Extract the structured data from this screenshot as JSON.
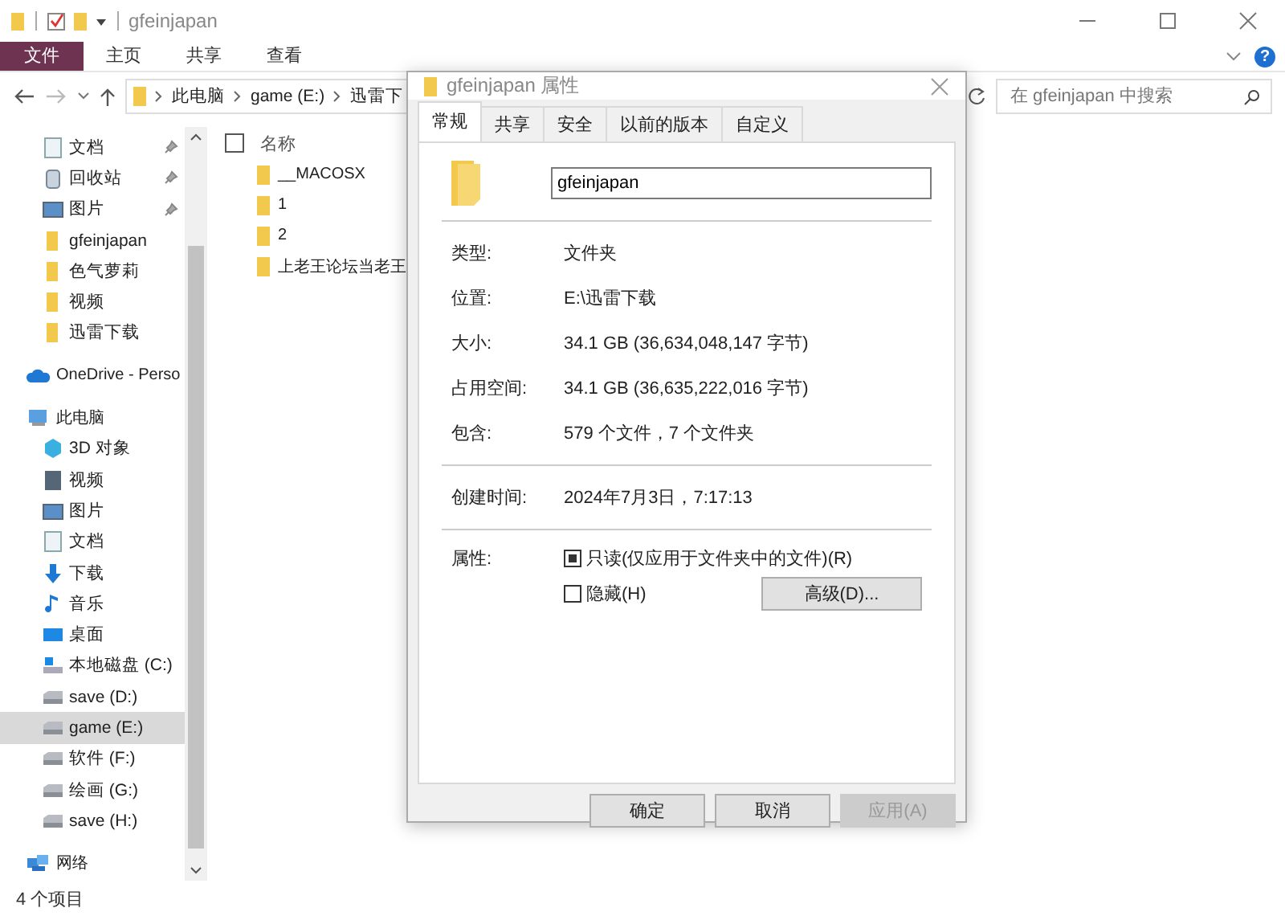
{
  "window": {
    "title": "gfeinjapan"
  },
  "ribbon": {
    "tabs": [
      {
        "label": "文件",
        "selected": true
      },
      {
        "label": "主页",
        "selected": false
      },
      {
        "label": "共享",
        "selected": false
      },
      {
        "label": "查看",
        "selected": false
      }
    ],
    "help": "?"
  },
  "address": {
    "crumbs": [
      "此电脑",
      "game (E:)",
      "迅雷下"
    ]
  },
  "search": {
    "placeholder": "在 gfeinjapan 中搜索"
  },
  "sidebar": {
    "quick_access": [
      {
        "label": "文档",
        "kind": "doc",
        "pinned": true,
        "selected": false
      },
      {
        "label": "回收站",
        "kind": "recycle",
        "pinned": true,
        "selected": false
      },
      {
        "label": "图片",
        "kind": "image",
        "pinned": true,
        "selected": false
      },
      {
        "label": "gfeinjapan",
        "kind": "folder",
        "pinned": false,
        "selected": false
      },
      {
        "label": "色气萝莉",
        "kind": "folder",
        "pinned": false,
        "selected": false
      },
      {
        "label": "视频",
        "kind": "folder",
        "pinned": false,
        "selected": false
      },
      {
        "label": "迅雷下载",
        "kind": "folder",
        "pinned": false,
        "selected": false
      }
    ],
    "roots": [
      {
        "label": "OneDrive - Perso",
        "kind": "cloud",
        "selected": false
      },
      {
        "label": "此电脑",
        "kind": "pc",
        "selected": false,
        "children": [
          {
            "label": "3D 对象",
            "kind": "cube",
            "selected": false
          },
          {
            "label": "视频",
            "kind": "video",
            "selected": false
          },
          {
            "label": "图片",
            "kind": "image",
            "selected": false
          },
          {
            "label": "文档",
            "kind": "doc",
            "selected": false
          },
          {
            "label": "下载",
            "kind": "download",
            "selected": false
          },
          {
            "label": "音乐",
            "kind": "music",
            "selected": false
          },
          {
            "label": "桌面",
            "kind": "desktop",
            "selected": false
          },
          {
            "label": "本地磁盘 (C:)",
            "kind": "sysdrive",
            "selected": false
          },
          {
            "label": "save (D:)",
            "kind": "drive",
            "selected": false
          },
          {
            "label": "game (E:)",
            "kind": "drive",
            "selected": true
          },
          {
            "label": "软件 (F:)",
            "kind": "drive",
            "selected": false
          },
          {
            "label": "绘画 (G:)",
            "kind": "drive",
            "selected": false
          },
          {
            "label": "save (H:)",
            "kind": "drive",
            "selected": false
          }
        ]
      },
      {
        "label": "网络",
        "kind": "network",
        "selected": false
      }
    ]
  },
  "files": {
    "column": "名称",
    "checked": false,
    "items": [
      "__MACOSX",
      "1",
      "2",
      "上老王论坛当老王"
    ]
  },
  "status_bar": "4 个项目",
  "dialog": {
    "title": "gfeinjapan 属性",
    "tabs": [
      {
        "label": "常规",
        "selected": true
      },
      {
        "label": "共享",
        "selected": false
      },
      {
        "label": "安全",
        "selected": false
      },
      {
        "label": "以前的版本",
        "selected": false
      },
      {
        "label": "自定义",
        "selected": false
      }
    ],
    "name": "gfeinjapan",
    "groups": [
      [
        {
          "label": "类型:",
          "value": "文件夹"
        },
        {
          "label": "位置:",
          "value": "E:\\迅雷下载"
        },
        {
          "label": "大小:",
          "value": "34.1 GB (36,634,048,147 字节)"
        },
        {
          "label": "占用空间:",
          "value": "34.1 GB (36,635,222,016 字节)"
        },
        {
          "label": "包含:",
          "value": "579 个文件，7 个文件夹"
        }
      ],
      [
        {
          "label": "创建时间:",
          "value": "2024年7月3日，7:17:13"
        }
      ]
    ],
    "attributes_label": "属性:",
    "attributes": [
      {
        "label": "只读(仅应用于文件夹中的文件)(R)",
        "mixed": true
      },
      {
        "label": "隐藏(H)",
        "mixed": false
      }
    ],
    "advanced": "高级(D)...",
    "buttons": [
      {
        "label": "确定",
        "disabled": false
      },
      {
        "label": "取消",
        "disabled": false
      },
      {
        "label": "应用(A)",
        "disabled": true
      }
    ]
  }
}
